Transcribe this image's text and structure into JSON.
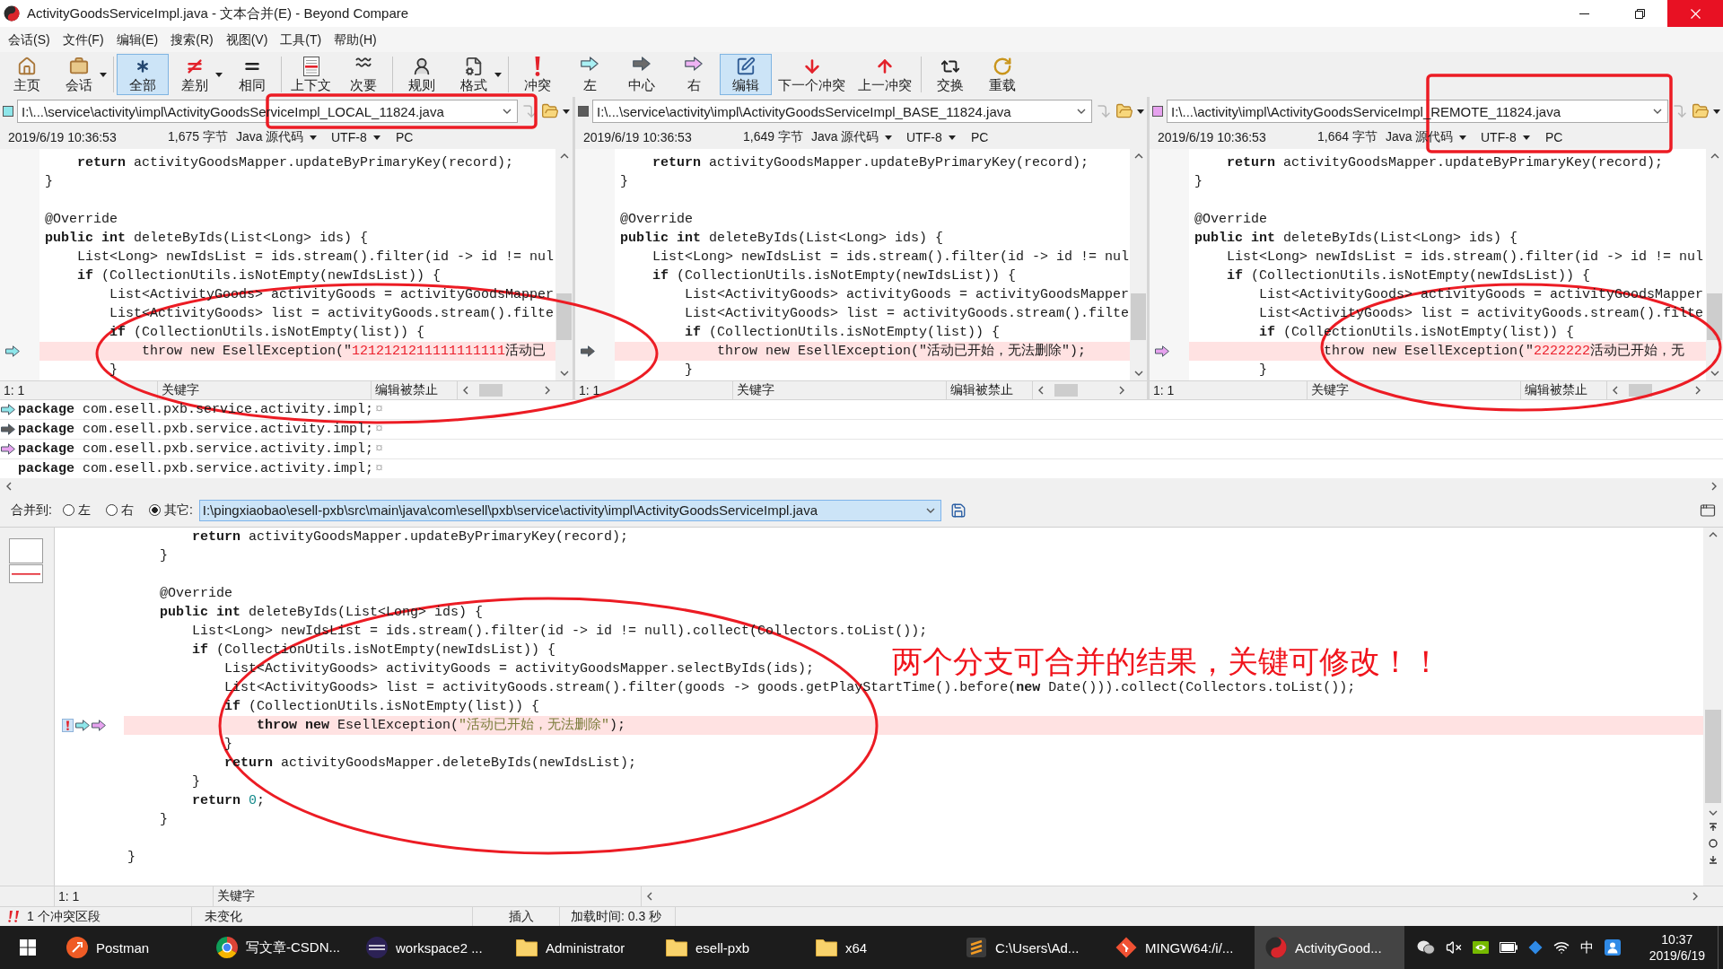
{
  "window": {
    "title": "ActivityGoodsServiceImpl.java - 文本合并(E) - Beyond Compare"
  },
  "menu": [
    "会话(S)",
    "文件(F)",
    "编辑(E)",
    "搜索(R)",
    "视图(V)",
    "工具(T)",
    "帮助(H)"
  ],
  "toolbar": [
    {
      "buttons": [
        {
          "label": "主页",
          "selected": false,
          "dropdown": false
        },
        {
          "label": "会话",
          "selected": false,
          "dropdown": true
        }
      ]
    },
    {
      "buttons": [
        {
          "label": "全部",
          "selected": true,
          "dropdown": false
        },
        {
          "label": "差别",
          "selected": false,
          "dropdown": true
        },
        {
          "label": "相同",
          "selected": false,
          "dropdown": false
        }
      ]
    },
    {
      "buttons": [
        {
          "label": "上下文",
          "selected": false,
          "dropdown": false
        },
        {
          "label": "次要",
          "selected": false,
          "dropdown": false
        }
      ]
    },
    {
      "buttons": [
        {
          "label": "规则",
          "selected": false,
          "dropdown": false
        },
        {
          "label": "格式",
          "selected": false,
          "dropdown": true
        }
      ]
    },
    {
      "buttons": [
        {
          "label": "冲突",
          "selected": false,
          "dropdown": false
        },
        {
          "label": "左",
          "selected": false,
          "dropdown": false
        },
        {
          "label": "中心",
          "selected": false,
          "dropdown": false
        },
        {
          "label": "右",
          "selected": false,
          "dropdown": false
        },
        {
          "label": "编辑",
          "selected": true,
          "dropdown": false
        },
        {
          "label": "下一个冲突",
          "selected": false,
          "dropdown": false
        },
        {
          "label": "上一冲突",
          "selected": false,
          "dropdown": false
        }
      ]
    },
    {
      "buttons": [
        {
          "label": "交换",
          "selected": false,
          "dropdown": false
        },
        {
          "label": "重载",
          "selected": false,
          "dropdown": false
        }
      ]
    }
  ],
  "panes": [
    {
      "color": "#8ee6ea",
      "path": "I:\\...\\service\\activity\\impl\\ActivityGoodsServiceImpl_LOCAL_11824.java",
      "date": "2019/6/19 10:36:53",
      "size": "1,675 字节",
      "format": "Java 源代码",
      "encoding": "UTF-8",
      "line_ending": "PC",
      "lines": [
        {
          "kind": "code",
          "text": "    **return** activityGoodsMapper.updateByPrimaryKey(record);"
        },
        {
          "kind": "code",
          "text": "}"
        },
        {
          "kind": "blank"
        },
        {
          "kind": "code",
          "text": "@Override"
        },
        {
          "kind": "code",
          "text": "**public** **int** deleteByIds(List<Long> ids) {"
        },
        {
          "kind": "code",
          "text": "    List<Long> newIdsList = ids.stream().filter(id -> id != nul"
        },
        {
          "kind": "code",
          "text": "    **if** (CollectionUtils.isNotEmpty(newIdsList)) {"
        },
        {
          "kind": "code",
          "text": "        List<ActivityGoods> activityGoods = activityGoodsMapper"
        },
        {
          "kind": "code",
          "text": "        List<ActivityGoods> list = activityGoods.stream().filte"
        },
        {
          "kind": "code",
          "text": "        **if** (CollectionUtils.isNotEmpty(list)) {"
        },
        {
          "kind": "conflict",
          "parts": [
            {
              "kind": "code",
              "text": "            throw new EsellException(\""
            },
            {
              "kind": "changed",
              "text": "1212121211111111111"
            },
            {
              "kind": "code",
              "text": "活动已"
            }
          ]
        },
        {
          "kind": "code",
          "text": "        }"
        }
      ],
      "cursor": "1: 1",
      "mode": "关键字",
      "edit_state": "编辑被禁止"
    },
    {
      "color": "#5c5c5c",
      "path": "I:\\...\\service\\activity\\impl\\ActivityGoodsServiceImpl_BASE_11824.java",
      "date": "2019/6/19 10:36:53",
      "size": "1,649 字节",
      "format": "Java 源代码",
      "encoding": "UTF-8",
      "line_ending": "PC",
      "lines": [
        {
          "kind": "code",
          "text": "    **return** activityGoodsMapper.updateByPrimaryKey(record);"
        },
        {
          "kind": "code",
          "text": "}"
        },
        {
          "kind": "blank"
        },
        {
          "kind": "code",
          "text": "@Override"
        },
        {
          "kind": "code",
          "text": "**public** **int** deleteByIds(List<Long> ids) {"
        },
        {
          "kind": "code",
          "text": "    List<Long> newIdsList = ids.stream().filter(id -> id != nul"
        },
        {
          "kind": "code",
          "text": "    **if** (CollectionUtils.isNotEmpty(newIdsList)) {"
        },
        {
          "kind": "code",
          "text": "        List<ActivityGoods> activityGoods = activityGoodsMapper"
        },
        {
          "kind": "code",
          "text": "        List<ActivityGoods> list = activityGoods.stream().filte"
        },
        {
          "kind": "code",
          "text": "        **if** (CollectionUtils.isNotEmpty(list)) {"
        },
        {
          "kind": "conflict",
          "text": "            throw new EsellException(\"活动已开始，无法删除\");"
        },
        {
          "kind": "code",
          "text": "        }"
        }
      ],
      "cursor": "1: 1",
      "mode": "关键字",
      "edit_state": "编辑被禁止"
    },
    {
      "color": "#e6a2ee",
      "path": "I:\\...\\activity\\impl\\ActivityGoodsServiceImpl_REMOTE_11824.java",
      "date": "2019/6/19 10:36:53",
      "size": "1,664 字节",
      "format": "Java 源代码",
      "encoding": "UTF-8",
      "line_ending": "PC",
      "lines": [
        {
          "kind": "code",
          "text": "    **return** activityGoodsMapper.updateByPrimaryKey(record);"
        },
        {
          "kind": "code",
          "text": "}"
        },
        {
          "kind": "blank"
        },
        {
          "kind": "code",
          "text": "@Override"
        },
        {
          "kind": "code",
          "text": "**public** **int** deleteByIds(List<Long> ids) {"
        },
        {
          "kind": "code",
          "text": "    List<Long> newIdsList = ids.stream().filter(id -> id != nul"
        },
        {
          "kind": "code",
          "text": "    **if** (CollectionUtils.isNotEmpty(newIdsList)) {"
        },
        {
          "kind": "code",
          "text": "        List<ActivityGoods> activityGoods = activityGoodsMapper"
        },
        {
          "kind": "code",
          "text": "        List<ActivityGoods> list = activityGoods.stream().filte"
        },
        {
          "kind": "code",
          "text": "        **if** (CollectionUtils.isNotEmpty(list)) {"
        },
        {
          "kind": "conflict",
          "parts": [
            {
              "kind": "code",
              "text": "                throw new EsellException(\""
            },
            {
              "kind": "changed",
              "text": "2222222"
            },
            {
              "kind": "code",
              "text": "活动已开始，无"
            }
          ]
        },
        {
          "kind": "code",
          "text": "        }"
        }
      ],
      "cursor": "1: 1",
      "mode": "关键字",
      "edit_state": "编辑被禁止"
    }
  ],
  "line_details": [
    {
      "marker": true,
      "text": "**package** com.esell.pxb.service.activity.impl;",
      "end_mark": "¤"
    },
    {
      "marker": true,
      "text": "**package** com.esell.pxb.service.activity.impl;",
      "end_mark": "¤"
    },
    {
      "marker": true,
      "text": "**package** com.esell.pxb.service.activity.impl;",
      "end_mark": "¤"
    },
    {
      "marker": false,
      "text": "**package** com.esell.pxb.service.activity.impl;",
      "end_mark": "¤"
    }
  ],
  "merge_target": {
    "label": "合并到:",
    "options": [
      {
        "label": "左",
        "selected": false
      },
      {
        "label": "右",
        "selected": false
      },
      {
        "label": "其它:",
        "selected": true
      }
    ],
    "path": "I:\\pingxiaobao\\esell-pxb\\src\\main\\java\\com\\esell\\pxb\\service\\activity\\impl\\ActivityGoodsServiceImpl.java"
  },
  "output": {
    "lines": [
      {
        "kind": "code",
        "text": "        **return** activityGoodsMapper.updateByPrimaryKey(record);"
      },
      {
        "kind": "code",
        "text": "    }"
      },
      {
        "kind": "blank"
      },
      {
        "kind": "code",
        "text": "    @Override"
      },
      {
        "kind": "code",
        "text": "    **public** **int** deleteByIds(List<Long> ids) {"
      },
      {
        "kind": "code",
        "text": "        List<Long> newIdsList = ids.stream().filter(id -> id != null).collect(Collectors.toList());"
      },
      {
        "kind": "code",
        "text": "        **if** (CollectionUtils.isNotEmpty(newIdsList)) {"
      },
      {
        "kind": "code",
        "text": "            List<ActivityGoods> activityGoods = activityGoodsMapper.selectByIds(ids);"
      },
      {
        "kind": "code",
        "text": "            List<ActivityGoods> list = activityGoods.stream().filter(goods -> goods.getPlayStartTime().before(**new** Date())).collect(Collectors.toList());"
      },
      {
        "kind": "code",
        "text": "            **if** (CollectionUtils.isNotEmpty(list)) {"
      },
      {
        "kind": "conflict",
        "parts": [
          {
            "kind": "code",
            "text": "                **throw** **new** EsellException("
          },
          {
            "kind": "string",
            "text": "\"活动已开始，无法删除\""
          },
          {
            "kind": "code",
            "text": ");"
          }
        ]
      },
      {
        "kind": "code",
        "text": "            }"
      },
      {
        "kind": "code",
        "text": "            **return** activityGoodsMapper.deleteByIds(newIdsList);"
      },
      {
        "kind": "code",
        "text": "        }"
      },
      {
        "kind": "code",
        "parts": [
          {
            "kind": "code",
            "text": "        **return** "
          },
          {
            "kind": "number",
            "text": "0"
          },
          {
            "kind": "code",
            "text": ";"
          }
        ]
      },
      {
        "kind": "code",
        "text": "    }"
      },
      {
        "kind": "blank"
      },
      {
        "kind": "code",
        "text": "}"
      }
    ],
    "cursor": "1: 1",
    "mode": "关键字"
  },
  "status_bar": {
    "conflicts": "1 个冲突区段",
    "change_state": "未变化",
    "insert_mode": "插入",
    "load_time": "加载时间: 0.3 秒"
  },
  "annotation_note": "两个分支可合并的结果，关键可修改！！",
  "taskbar": {
    "items": [
      {
        "label": "Postman",
        "selected": false
      },
      {
        "label": "写文章-CSDN...",
        "selected": false
      },
      {
        "label": "workspace2 ...",
        "selected": false
      },
      {
        "label": "Administrator",
        "selected": false
      },
      {
        "label": "esell-pxb",
        "selected": false
      },
      {
        "label": "x64",
        "selected": false
      },
      {
        "label": "C:\\Users\\Ad...",
        "selected": false
      },
      {
        "label": "MINGW64:/i/...",
        "selected": false
      },
      {
        "label": "ActivityGood...",
        "selected": true
      }
    ],
    "ime": "中",
    "time": "10:37",
    "date": "2019/6/19"
  }
}
